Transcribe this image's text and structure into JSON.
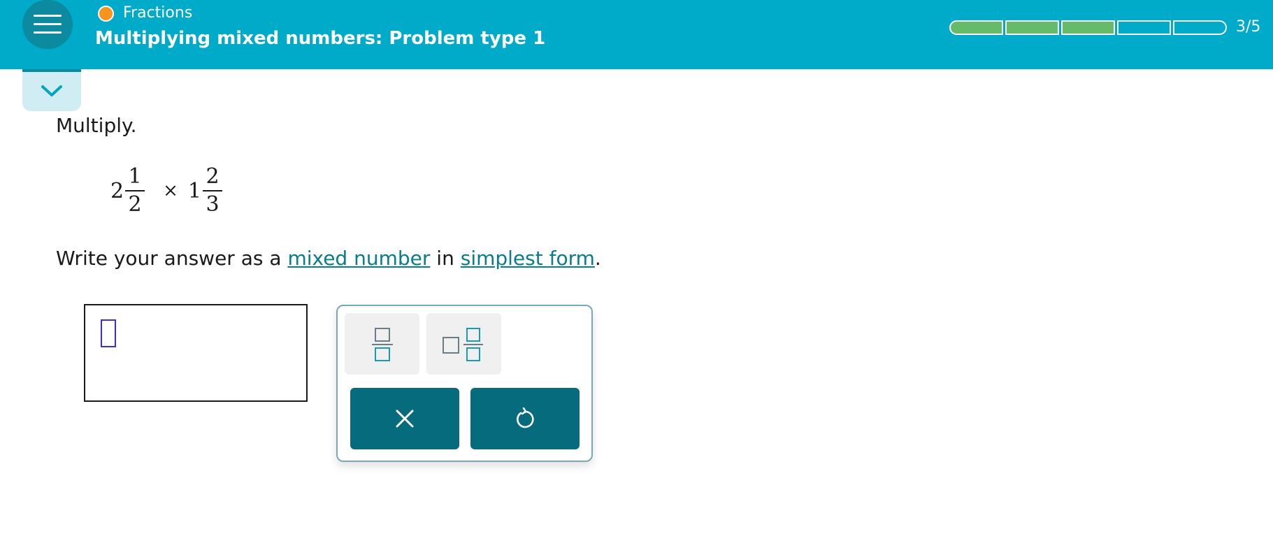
{
  "header": {
    "topic": "Fractions",
    "problem_title": "Multiplying mixed numbers: Problem type 1",
    "progress": {
      "completed": 3,
      "total": 5,
      "label": "3/5"
    },
    "colors": {
      "bar": "#00abc9",
      "topic_dot": "#f7941d",
      "progress_fill": "#66bb6a"
    }
  },
  "icons": {
    "menu": "hamburger-menu-icon",
    "collapse": "chevron-down-icon",
    "fraction_template": "fraction-template-icon",
    "mixed_template": "mixed-number-template-icon",
    "clear": "x-icon",
    "undo": "undo-icon"
  },
  "problem": {
    "instruction": "Multiply.",
    "expression": {
      "left": {
        "whole": "2",
        "numerator": "1",
        "denominator": "2"
      },
      "operator": "×",
      "right": {
        "whole": "1",
        "numerator": "2",
        "denominator": "3"
      }
    },
    "answer_instruction": {
      "prefix": "Write your answer as a",
      "link1": "mixed number",
      "middle": "in",
      "link2": "simplest form",
      "suffix": "."
    }
  },
  "answer": {
    "value": ""
  }
}
